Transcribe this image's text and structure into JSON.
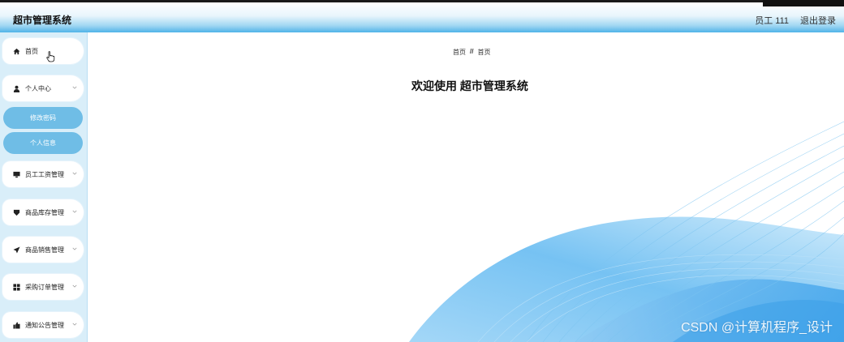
{
  "header": {
    "app_title": "超市管理系统",
    "user_label": "员工 111",
    "logout_label": "退出登录"
  },
  "sidebar": {
    "items": [
      {
        "label": "首页",
        "icon": "home-icon"
      },
      {
        "label": "个人中心",
        "icon": "user-icon"
      },
      {
        "label": "员工工资管理",
        "icon": "monitor-icon"
      },
      {
        "label": "商品库存管理",
        "icon": "badge-icon"
      },
      {
        "label": "商品销售管理",
        "icon": "send-icon"
      },
      {
        "label": "采购订单管理",
        "icon": "grid-icon"
      },
      {
        "label": "通知公告管理",
        "icon": "thumb-icon"
      }
    ],
    "subitems": [
      {
        "label": "修改密码"
      },
      {
        "label": "个人信息"
      }
    ]
  },
  "main": {
    "breadcrumb": {
      "home": "首页",
      "separator": "//",
      "current": "首页"
    },
    "welcome": "欢迎使用 超市管理系统"
  },
  "watermark": "CSDN @计算机程序_设计",
  "colors": {
    "accent": "#4fb3e8",
    "submenu": "#6fbde6",
    "sidebar": "#d9eef9"
  }
}
